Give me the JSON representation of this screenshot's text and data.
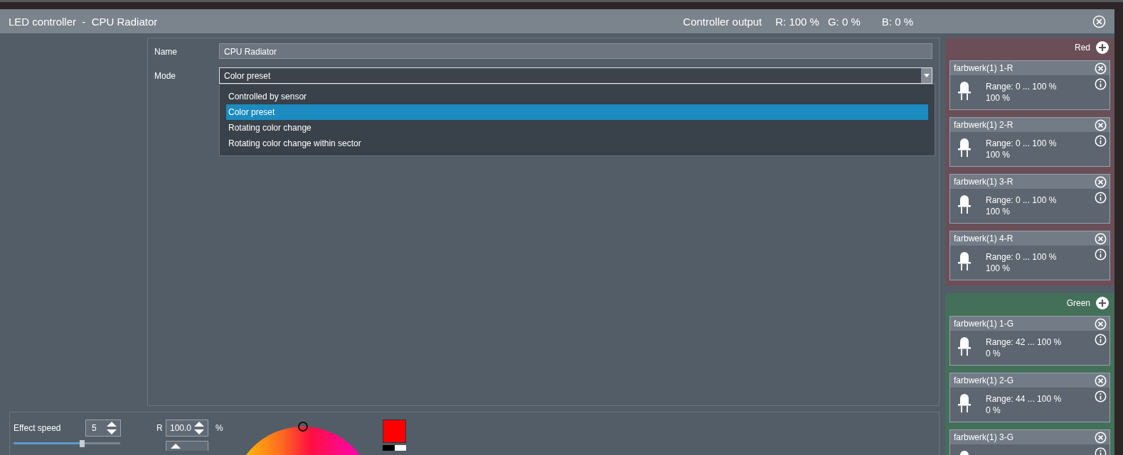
{
  "window": {
    "title": "LED controller  -  CPU Radiator",
    "output_label": "Controller output",
    "output_r": "R: 100 %",
    "output_g": "G: 0 %",
    "output_b": "B: 0 %"
  },
  "form": {
    "name_label": "Name",
    "name_value": "CPU Radiator",
    "mode_label": "Mode",
    "mode_value": "Color preset",
    "mode_options": [
      {
        "label": "Controlled by sensor",
        "selected": false
      },
      {
        "label": "Color preset",
        "selected": true
      },
      {
        "label": "Rotating color change",
        "selected": false
      },
      {
        "label": "Rotating color change within sector",
        "selected": false
      }
    ]
  },
  "effect": {
    "speed_label": "Effect speed",
    "speed_value": "5",
    "speed_slider": {
      "level": 0.64
    },
    "r_label": "R",
    "r_value": "100.0",
    "r_unit": "%",
    "preview": {
      "color": "#ff0000"
    }
  },
  "groups": [
    {
      "name": "Red",
      "color": "#6a4f58",
      "outputs": [
        {
          "name": "farbwerk(1) 1-R",
          "range": "Range:  0 ... 100  %",
          "value": "100 %"
        },
        {
          "name": "farbwerk(1) 2-R",
          "range": "Range:  0 ... 100  %",
          "value": "100 %"
        },
        {
          "name": "farbwerk(1) 3-R",
          "range": "Range:  0 ... 100  %",
          "value": "100 %"
        },
        {
          "name": "farbwerk(1) 4-R",
          "range": "Range:  0 ... 100  %",
          "value": "100 %"
        }
      ]
    },
    {
      "name": "Green",
      "color": "#44705a",
      "outputs": [
        {
          "name": "farbwerk(1) 1-G",
          "range": "Range:  42 ... 100  %",
          "value": "0 %"
        },
        {
          "name": "farbwerk(1) 2-G",
          "range": "Range:  44 ... 100  %",
          "value": "0 %"
        },
        {
          "name": "farbwerk(1) 3-G"
        }
      ]
    }
  ]
}
